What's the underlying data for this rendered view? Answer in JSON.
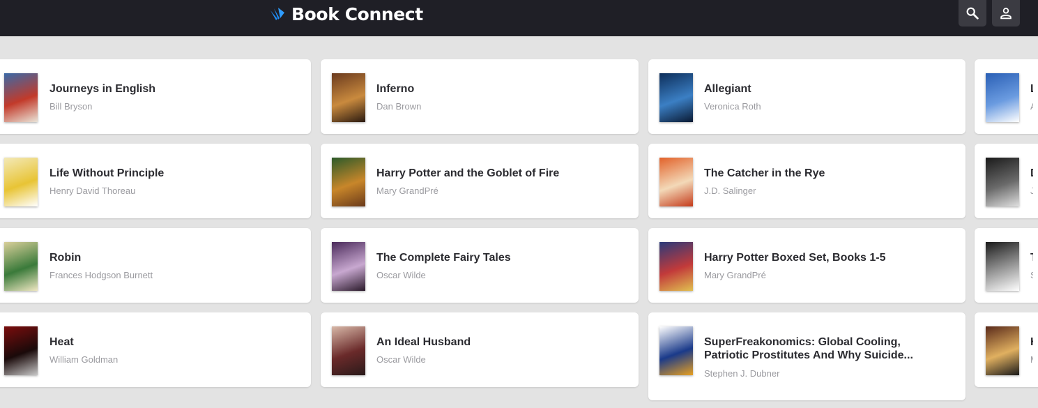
{
  "app": {
    "name": "Book Connect"
  },
  "header": {
    "search_icon": "search-icon",
    "account_icon": "account-icon"
  },
  "books": [
    {
      "title": "Journeys in English",
      "author": "Bill Bryson",
      "cover": [
        "#3a6aa8",
        "#c23a2a",
        "#e9e4d8"
      ]
    },
    {
      "title": "Inferno",
      "author": "Dan Brown",
      "cover": [
        "#6a3a1e",
        "#c98a3e",
        "#2a1a10"
      ]
    },
    {
      "title": "Allegiant",
      "author": "Veronica Roth",
      "cover": [
        "#0d2e5a",
        "#3b7fc4",
        "#0a1a33"
      ]
    },
    {
      "title": "Le",
      "author": "Ar",
      "cover": [
        "#2a5fb5",
        "#6a9be0",
        "#ffffff"
      ]
    },
    {
      "title": "Life Without Principle",
      "author": "Henry David Thoreau",
      "cover": [
        "#f3e9b8",
        "#e8c435",
        "#ffffff"
      ]
    },
    {
      "title": "Harry Potter and the Goblet of Fire",
      "author": "Mary GrandPré",
      "cover": [
        "#2b5a2a",
        "#c8862a",
        "#6a3a1a"
      ]
    },
    {
      "title": "The Catcher in the Rye",
      "author": "J.D. Salinger",
      "cover": [
        "#e2622a",
        "#f3d9b8",
        "#c43a1a"
      ]
    },
    {
      "title": "D",
      "author": "Jo",
      "cover": [
        "#1a1a1a",
        "#6a6a6a",
        "#e0e0e0"
      ]
    },
    {
      "title": "Robin",
      "author": "Frances Hodgson Burnett",
      "cover": [
        "#d9cf9a",
        "#3a7a3a",
        "#efe7c2"
      ]
    },
    {
      "title": "The Complete Fairy Tales",
      "author": "Oscar Wilde",
      "cover": [
        "#4a2a5a",
        "#c8a8d0",
        "#2a1a2a"
      ]
    },
    {
      "title": "Harry Potter Boxed Set, Books 1-5",
      "author": "Mary GrandPré",
      "cover": [
        "#2a3a7a",
        "#c23a3a",
        "#e0c050"
      ]
    },
    {
      "title": "T",
      "author": "Su",
      "cover": [
        "#1a1a1a",
        "#9a9a9a",
        "#ffffff"
      ]
    },
    {
      "title": "Heat",
      "author": "William Goldman",
      "cover": [
        "#7a0d0d",
        "#1a0a0a",
        "#c8c8c8"
      ]
    },
    {
      "title": "An Ideal Husband",
      "author": "Oscar Wilde",
      "cover": [
        "#d8b8a8",
        "#6a2a2a",
        "#2a1a1a"
      ]
    },
    {
      "title": "SuperFreakonomics: Global Cooling, Patriotic Prostitutes And Why Suicide Bombers Should Buy Life Insurance",
      "author": "Stephen J. Dubner",
      "cover": [
        "#ffffff",
        "#1a3a8a",
        "#e8a020"
      ]
    },
    {
      "title": "H",
      "author": "M",
      "cover": [
        "#5a2a1a",
        "#e0b060",
        "#1a1a1a"
      ]
    }
  ]
}
